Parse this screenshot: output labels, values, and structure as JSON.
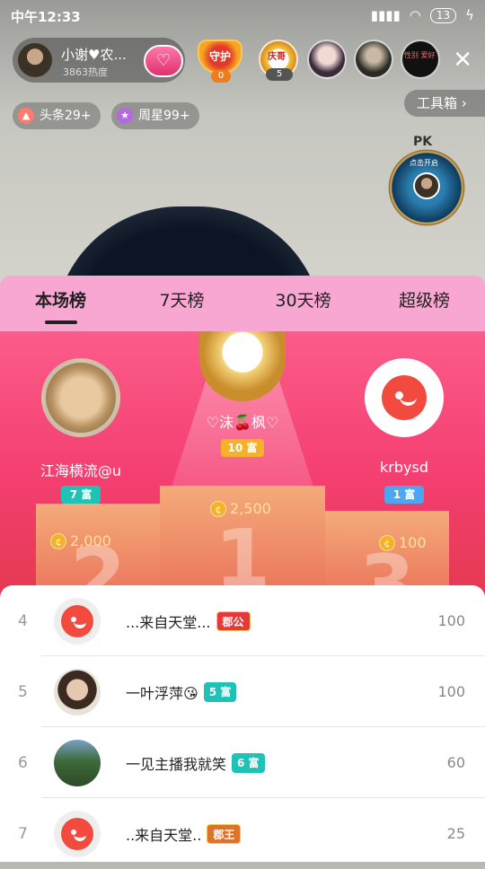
{
  "status_bar": {
    "time": "中午12:33",
    "battery": "13"
  },
  "streamer": {
    "name": "小谢♥农...",
    "heat": "3863热度",
    "follow_icon": "heart-hands-icon"
  },
  "guard": {
    "label": "守护",
    "count": "0"
  },
  "viewers": [
    {
      "badge": "5",
      "banner": "庆哥"
    },
    {},
    {},
    {
      "text": "性别 爱好"
    }
  ],
  "chips": [
    {
      "icon": "flame-icon",
      "label": "头条29+"
    },
    {
      "icon": "star-icon",
      "label": "周星99+"
    }
  ],
  "toolbox": {
    "label": "工具箱"
  },
  "pk": {
    "label": "PK",
    "sub": "点击开启"
  },
  "tabs": [
    {
      "label": "本场榜",
      "active": true
    },
    {
      "label": "7天榜",
      "active": false
    },
    {
      "label": "30天榜",
      "active": false
    },
    {
      "label": "超级榜",
      "active": false
    }
  ],
  "podium": {
    "first": {
      "name": "♡沫🍒枫♡",
      "badge": "10 富",
      "score": "2,500",
      "stand_number": "1"
    },
    "second": {
      "name": "江海横流@u",
      "badge": "7 富",
      "score": "2,000",
      "stand_number": "2"
    },
    "third": {
      "name": "krbysd",
      "badge": "1 富",
      "score": "100",
      "stand_number": "3"
    }
  },
  "list": [
    {
      "rank": "4",
      "name": "...来自天堂...",
      "tag": "郡公",
      "score": "100"
    },
    {
      "rank": "5",
      "name": "一叶浮萍😘",
      "tag": "5 富",
      "score": "100"
    },
    {
      "rank": "6",
      "name": "一见主播我就笑",
      "tag": "6 富",
      "score": "60"
    },
    {
      "rank": "7",
      "name": "..来自天堂..",
      "tag": "郡王",
      "score": "25"
    }
  ],
  "colors": {
    "tab_bg": "#f8a6d2",
    "podium_top": "#fb5c8a",
    "tag_red": "#e63a3a",
    "tag_teal": "#1ec3b6",
    "tag_blue": "#4fa6f0"
  }
}
